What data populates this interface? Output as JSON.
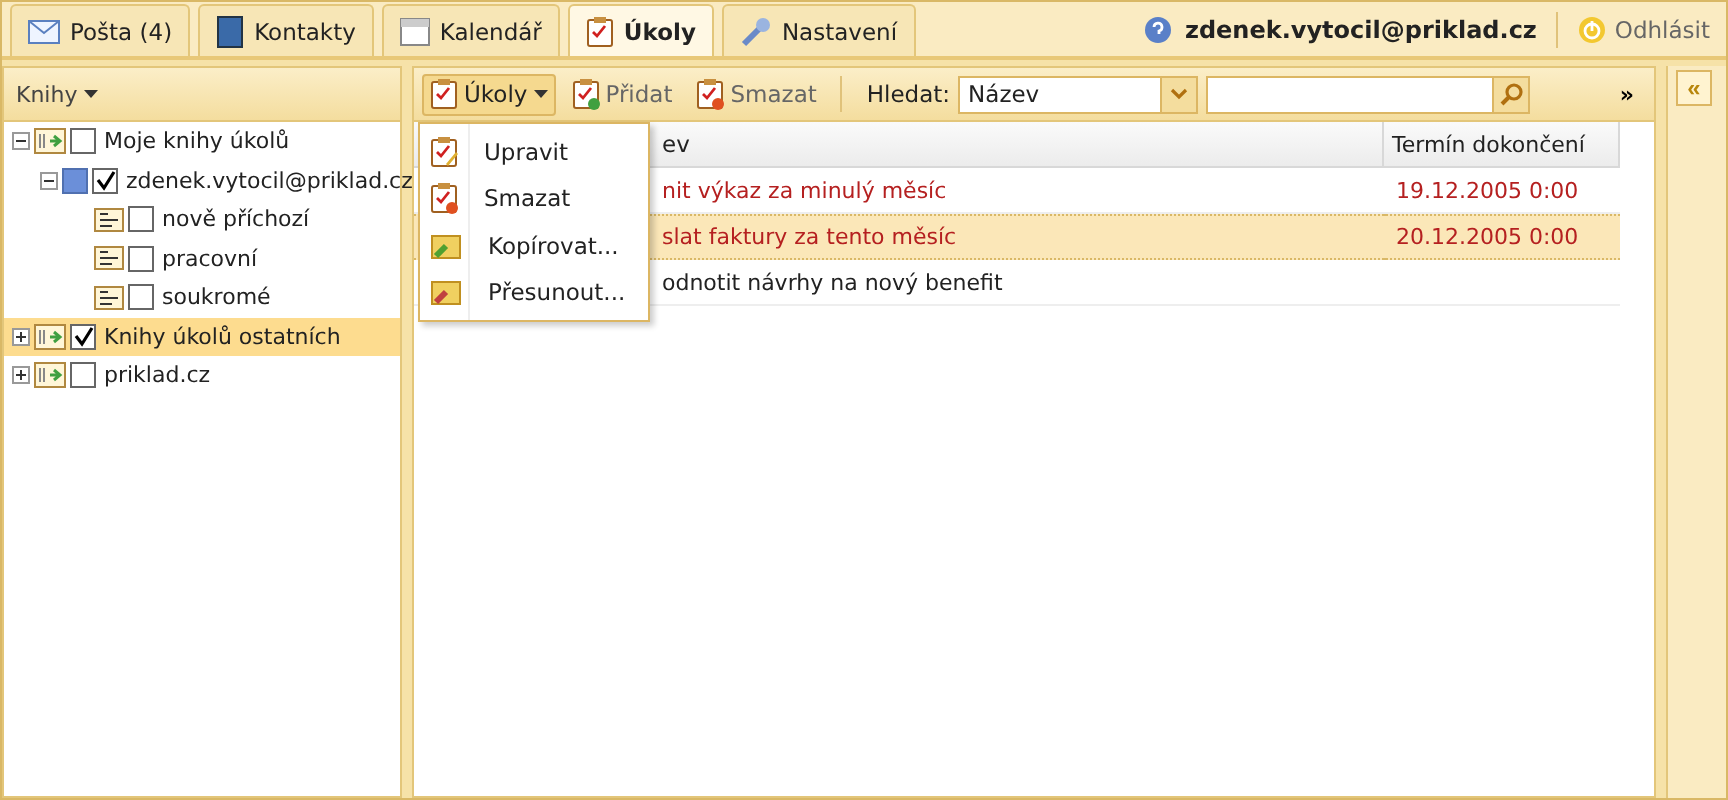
{
  "tabs": [
    {
      "label": "Pošta (4)",
      "selected": false
    },
    {
      "label": "Kontakty",
      "selected": false
    },
    {
      "label": "Kalendář",
      "selected": false
    },
    {
      "label": "Úkoly",
      "selected": true
    },
    {
      "label": "Nastavení",
      "selected": false
    }
  ],
  "user": {
    "email": "zdenek.vytocil@priklad.cz",
    "logout": "Odhlásit"
  },
  "sidebar": {
    "title": "Knihy",
    "tree": [
      {
        "label": "Moje knihy úkolů",
        "kind": "group",
        "expanded": true,
        "checked": false,
        "selected": false,
        "children": [
          {
            "label": "zdenek.vytocil@priklad.cz",
            "expanded": true,
            "checked": true,
            "selected": false,
            "color": "#6b8fd9",
            "children": [
              {
                "label": "nově příchozí",
                "kind": "list",
                "checked": false,
                "selected": false
              },
              {
                "label": "pracovní",
                "kind": "list",
                "checked": false,
                "selected": false
              },
              {
                "label": "soukromé",
                "kind": "list",
                "checked": false,
                "selected": false
              }
            ]
          }
        ]
      },
      {
        "label": "Knihy úkolů ostatních",
        "kind": "group",
        "expanded": false,
        "checked": true,
        "selected": true
      },
      {
        "label": "priklad.cz",
        "kind": "group",
        "expanded": false,
        "checked": false,
        "selected": false
      }
    ]
  },
  "toolbar": {
    "menu_button": "Úkoly",
    "add": "Přidat",
    "delete": "Smazat",
    "search_label": "Hledat:",
    "search_field": "Název",
    "more": "»"
  },
  "menu": [
    {
      "label": "Upravit"
    },
    {
      "label": "Smazat"
    },
    {
      "label": "Kopírovat..."
    },
    {
      "label": "Přesunout..."
    }
  ],
  "table": {
    "columns": [
      "ev",
      "Termín dokončení"
    ],
    "rows": [
      {
        "name": "nit výkaz za minulý měsíc",
        "due": "19.12.2005 0:00",
        "overdue": true,
        "selected": false
      },
      {
        "name": "slat faktury za tento měsíc",
        "due": "20.12.2005 0:00",
        "overdue": true,
        "selected": true
      },
      {
        "name": "odnotit návrhy na nový benefit",
        "overdue": false,
        "selected": false
      }
    ]
  },
  "collapse_button": "«"
}
